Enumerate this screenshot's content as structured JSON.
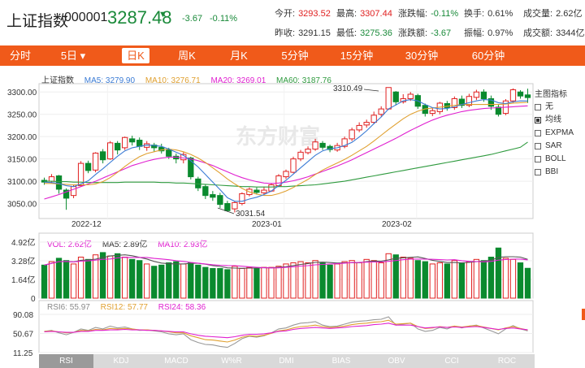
{
  "index": {
    "name": "上证指数",
    "code": "000001",
    "price": "3287.48",
    "arrow": "▼",
    "change": "-3.67",
    "change_pct": "-0.11%"
  },
  "stats": {
    "open_label": "今开:",
    "open": "3293.52",
    "high_label": "最高:",
    "high": "3307.44",
    "chg_label": "涨跌幅:",
    "chg": "-0.11%",
    "turnover_label": "换手:",
    "turnover": "0.61%",
    "volume_label": "成交量:",
    "volume": "2.62亿",
    "prev_label": "昨收:",
    "prev": "3291.15",
    "low_label": "最低:",
    "low": "3275.36",
    "chgamt_label": "涨跌额:",
    "chgamt": "-3.67",
    "amp_label": "振幅:",
    "amp": "0.97%",
    "amount_label": "成交额:",
    "amount": "3344亿"
  },
  "tabs": [
    "分时",
    "5日 ▾",
    "日K",
    "周K",
    "月K",
    "5分钟",
    "15分钟",
    "30分钟",
    "60分钟"
  ],
  "active_tab": "日K",
  "main_legend": {
    "name": "上证指数",
    "ma5": "MA5: 3279.90",
    "ma10": "MA10: 3276.71",
    "ma20": "MA20: 3269.01",
    "ma60": "MA60: 3187.76"
  },
  "vol_legend": {
    "vol": "VOL: 2.62亿",
    "ma5": "MA5: 2.89亿",
    "ma10": "MA10: 2.93亿"
  },
  "rsi_legend": {
    "rsi6": "RSI6: 55.97",
    "rsi12": "RSI12: 57.77",
    "rsi24": "RSI24: 58.36"
  },
  "price_axis": [
    "3300.00",
    "3250.00",
    "3200.00",
    "3150.00",
    "3100.00",
    "3050.00"
  ],
  "vol_axis": [
    "4.92亿",
    "3.28亿",
    "1.64亿",
    "0"
  ],
  "rsi_axis": [
    "90.08",
    "50.67",
    "11.25"
  ],
  "date_labels": [
    "2022-12",
    "2023-01",
    "2023-02"
  ],
  "annotations": {
    "high": "3310.49",
    "low": "3031.54"
  },
  "watermark": "东方财富",
  "side_panel": {
    "title": "主图指标",
    "items": [
      "无",
      "均线",
      "EXPMA",
      "SAR",
      "BOLL",
      "BBI"
    ],
    "checked": "均线"
  },
  "bottom_tabs": [
    "RSI",
    "KDJ",
    "MACD",
    "W%R",
    "DMI",
    "BIAS",
    "OBV",
    "CCI",
    "ROC"
  ],
  "active_bottom_tab": "RSI",
  "colors": {
    "up": "#e02020",
    "down": "#0a8a2e",
    "ma5": "#3a7bd5",
    "ma10": "#e0a030",
    "ma20": "#e020d0",
    "ma60": "#2e9a3e",
    "accent": "#f05a1a"
  },
  "chart_data": {
    "type": "candlestick",
    "candles": [
      [
        3102,
        3098,
        3108,
        3092
      ],
      [
        3100,
        3110,
        3116,
        3096
      ],
      [
        3112,
        3082,
        3114,
        3072
      ],
      [
        3080,
        3062,
        3084,
        3036
      ],
      [
        3068,
        3088,
        3092,
        3062
      ],
      [
        3090,
        3140,
        3145,
        3088
      ],
      [
        3140,
        3124,
        3146,
        3118
      ],
      [
        3125,
        3163,
        3165,
        3120
      ],
      [
        3166,
        3148,
        3172,
        3140
      ],
      [
        3150,
        3186,
        3190,
        3148
      ],
      [
        3185,
        3170,
        3190,
        3160
      ],
      [
        3175,
        3198,
        3200,
        3170
      ],
      [
        3195,
        3188,
        3202,
        3180
      ],
      [
        3192,
        3178,
        3198,
        3170
      ],
      [
        3176,
        3184,
        3190,
        3168
      ],
      [
        3181,
        3175,
        3186,
        3166
      ],
      [
        3176,
        3168,
        3184,
        3162
      ],
      [
        3170,
        3156,
        3175,
        3150
      ],
      [
        3156,
        3150,
        3162,
        3140
      ],
      [
        3148,
        3160,
        3165,
        3140
      ],
      [
        3152,
        3110,
        3155,
        3104
      ],
      [
        3105,
        3085,
        3110,
        3078
      ],
      [
        3088,
        3068,
        3092,
        3060
      ],
      [
        3070,
        3064,
        3078,
        3056
      ],
      [
        3068,
        3048,
        3074,
        3040
      ],
      [
        3050,
        3034,
        3056,
        3031.54
      ],
      [
        3038,
        3052,
        3056,
        3030
      ],
      [
        3050,
        3072,
        3075,
        3046
      ],
      [
        3070,
        3082,
        3086,
        3066
      ],
      [
        3080,
        3075,
        3086,
        3070
      ],
      [
        3074,
        3080,
        3088,
        3070
      ],
      [
        3078,
        3092,
        3096,
        3076
      ],
      [
        3090,
        3112,
        3116,
        3088
      ],
      [
        3110,
        3122,
        3126,
        3105
      ],
      [
        3120,
        3150,
        3155,
        3118
      ],
      [
        3150,
        3165,
        3170,
        3145
      ],
      [
        3164,
        3172,
        3178,
        3160
      ],
      [
        3172,
        3188,
        3195,
        3168
      ],
      [
        3185,
        3176,
        3190,
        3170
      ],
      [
        3178,
        3171,
        3182,
        3165
      ],
      [
        3170,
        3180,
        3186,
        3166
      ],
      [
        3178,
        3195,
        3200,
        3174
      ],
      [
        3195,
        3215,
        3220,
        3190
      ],
      [
        3215,
        3225,
        3232,
        3210
      ],
      [
        3226,
        3232,
        3238,
        3220
      ],
      [
        3232,
        3248,
        3256,
        3228
      ],
      [
        3250,
        3262,
        3268,
        3245
      ],
      [
        3262,
        3310,
        3310.49,
        3260
      ],
      [
        3300,
        3278,
        3302,
        3270
      ],
      [
        3278,
        3285,
        3295,
        3274
      ],
      [
        3285,
        3295,
        3300,
        3280
      ],
      [
        3292,
        3268,
        3296,
        3262
      ],
      [
        3270,
        3252,
        3274,
        3245
      ],
      [
        3252,
        3258,
        3265,
        3246
      ],
      [
        3256,
        3275,
        3278,
        3250
      ],
      [
        3274,
        3265,
        3280,
        3258
      ],
      [
        3265,
        3285,
        3290,
        3260
      ],
      [
        3284,
        3270,
        3292,
        3264
      ],
      [
        3270,
        3290,
        3296,
        3266
      ],
      [
        3288,
        3300,
        3305,
        3282
      ],
      [
        3300,
        3285,
        3306,
        3278
      ],
      [
        3285,
        3268,
        3292,
        3260
      ],
      [
        3266,
        3250,
        3272,
        3245
      ],
      [
        3252,
        3280,
        3284,
        3248
      ],
      [
        3280,
        3305,
        3308,
        3276
      ],
      [
        3300,
        3291,
        3304,
        3285
      ],
      [
        3293.52,
        3287.48,
        3307.44,
        3275.36
      ]
    ],
    "ma5": [
      3098,
      3097,
      3095,
      3090,
      3088,
      3094,
      3101,
      3115,
      3128,
      3142,
      3156,
      3168,
      3175,
      3178,
      3181,
      3180,
      3178,
      3172,
      3165,
      3158,
      3146,
      3132,
      3115,
      3098,
      3081,
      3063,
      3055,
      3055,
      3060,
      3064,
      3070,
      3078,
      3090,
      3102,
      3116,
      3130,
      3144,
      3158,
      3168,
      3173,
      3175,
      3180,
      3187,
      3199,
      3213,
      3229,
      3244,
      3262,
      3271,
      3280,
      3283,
      3280,
      3272,
      3265,
      3262,
      3263,
      3267,
      3272,
      3276,
      3280,
      3283,
      3282,
      3276,
      3274,
      3278,
      3280,
      3279.9
    ],
    "ma10": [
      3095,
      3095,
      3094,
      3093,
      3092,
      3092,
      3092,
      3094,
      3099,
      3108,
      3120,
      3133,
      3145,
      3155,
      3162,
      3166,
      3170,
      3172,
      3170,
      3166,
      3160,
      3152,
      3142,
      3130,
      3118,
      3105,
      3094,
      3084,
      3076,
      3071,
      3068,
      3068,
      3072,
      3078,
      3086,
      3095,
      3104,
      3115,
      3125,
      3133,
      3141,
      3149,
      3158,
      3168,
      3178,
      3190,
      3203,
      3216,
      3228,
      3240,
      3250,
      3257,
      3262,
      3264,
      3266,
      3268,
      3270,
      3272,
      3272,
      3272,
      3272,
      3272,
      3272,
      3273,
      3275,
      3276,
      3276.71
    ],
    "ma20": [
      3060,
      3065,
      3070,
      3076,
      3082,
      3088,
      3094,
      3100,
      3107,
      3114,
      3121,
      3128,
      3135,
      3140,
      3145,
      3149,
      3152,
      3154,
      3154,
      3152,
      3150,
      3146,
      3141,
      3135,
      3128,
      3121,
      3114,
      3108,
      3103,
      3099,
      3096,
      3095,
      3096,
      3098,
      3101,
      3105,
      3110,
      3116,
      3122,
      3128,
      3134,
      3141,
      3148,
      3156,
      3164,
      3172,
      3180,
      3188,
      3196,
      3205,
      3214,
      3222,
      3230,
      3237,
      3243,
      3248,
      3252,
      3256,
      3259,
      3261,
      3263,
      3264,
      3265,
      3266,
      3267,
      3268,
      3269.01
    ],
    "ma60": [
      3100,
      3100,
      3099,
      3099,
      3098,
      3098,
      3097,
      3097,
      3097,
      3097,
      3097,
      3098,
      3098,
      3098,
      3098,
      3098,
      3097,
      3097,
      3096,
      3096,
      3095,
      3094,
      3093,
      3092,
      3091,
      3090,
      3089,
      3088,
      3088,
      3087,
      3087,
      3087,
      3088,
      3088,
      3089,
      3090,
      3091,
      3092,
      3094,
      3096,
      3098,
      3100,
      3103,
      3106,
      3109,
      3112,
      3115,
      3118,
      3121,
      3124,
      3127,
      3130,
      3133,
      3136,
      3139,
      3142,
      3145,
      3148,
      3151,
      3154,
      3157,
      3160,
      3164,
      3168,
      3172,
      3176,
      3187.76
    ],
    "volume": [
      2.9,
      3.2,
      3.5,
      3.3,
      3.0,
      3.6,
      3.4,
      3.8,
      4.0,
      3.7,
      3.9,
      3.6,
      3.4,
      3.3,
      3.0,
      2.8,
      2.9,
      3.1,
      3.2,
      3.0,
      3.1,
      2.9,
      2.7,
      2.6,
      2.6,
      2.5,
      2.8,
      2.6,
      2.7,
      2.6,
      2.7,
      2.7,
      2.8,
      3.0,
      3.1,
      3.2,
      3.1,
      3.3,
      3.1,
      2.9,
      3.0,
      3.2,
      3.3,
      3.1,
      3.4,
      3.3,
      3.1,
      3.9,
      3.8,
      3.6,
      3.5,
      3.3,
      3.2,
      3.0,
      3.1,
      3.0,
      3.3,
      3.1,
      3.2,
      3.4,
      3.3,
      3.6,
      4.4,
      3.5,
      3.4,
      3.1,
      2.62
    ],
    "rsi6": [
      55,
      57,
      52,
      48,
      53,
      60,
      57,
      63,
      60,
      66,
      62,
      64,
      60,
      57,
      58,
      56,
      54,
      50,
      48,
      50,
      38,
      32,
      28,
      27,
      24,
      22,
      30,
      40,
      45,
      43,
      46,
      52,
      60,
      62,
      68,
      72,
      73,
      75,
      68,
      65,
      66,
      70,
      74,
      76,
      77,
      79,
      80,
      85,
      68,
      70,
      72,
      60,
      55,
      57,
      63,
      60,
      66,
      62,
      66,
      68,
      62,
      56,
      50,
      60,
      67,
      60,
      55.97
    ],
    "rsi12": [
      55,
      56,
      54,
      52,
      53,
      57,
      56,
      59,
      58,
      61,
      60,
      61,
      60,
      58,
      58,
      57,
      56,
      54,
      52,
      52,
      46,
      42,
      38,
      37,
      35,
      33,
      37,
      43,
      46,
      45,
      47,
      51,
      56,
      58,
      62,
      65,
      66,
      68,
      65,
      63,
      64,
      66,
      69,
      71,
      72,
      74,
      75,
      78,
      70,
      71,
      72,
      65,
      61,
      62,
      65,
      63,
      66,
      64,
      66,
      67,
      64,
      61,
      58,
      62,
      65,
      61,
      57.77
    ],
    "rsi24": [
      54,
      55,
      54,
      53,
      53,
      55,
      55,
      57,
      57,
      58,
      58,
      59,
      58,
      58,
      57,
      57,
      56,
      55,
      54,
      54,
      50,
      47,
      45,
      44,
      43,
      42,
      44,
      47,
      49,
      49,
      50,
      52,
      55,
      56,
      59,
      61,
      62,
      63,
      62,
      61,
      62,
      63,
      65,
      66,
      67,
      69,
      70,
      72,
      68,
      68,
      68,
      65,
      62,
      63,
      64,
      63,
      64,
      63,
      64,
      65,
      63,
      61,
      59,
      61,
      62,
      60,
      58.36
    ],
    "ylim": [
      3020,
      3315
    ],
    "vol_ylim": [
      0,
      4.92
    ],
    "rsi_ylim": [
      11.25,
      90.08
    ]
  }
}
